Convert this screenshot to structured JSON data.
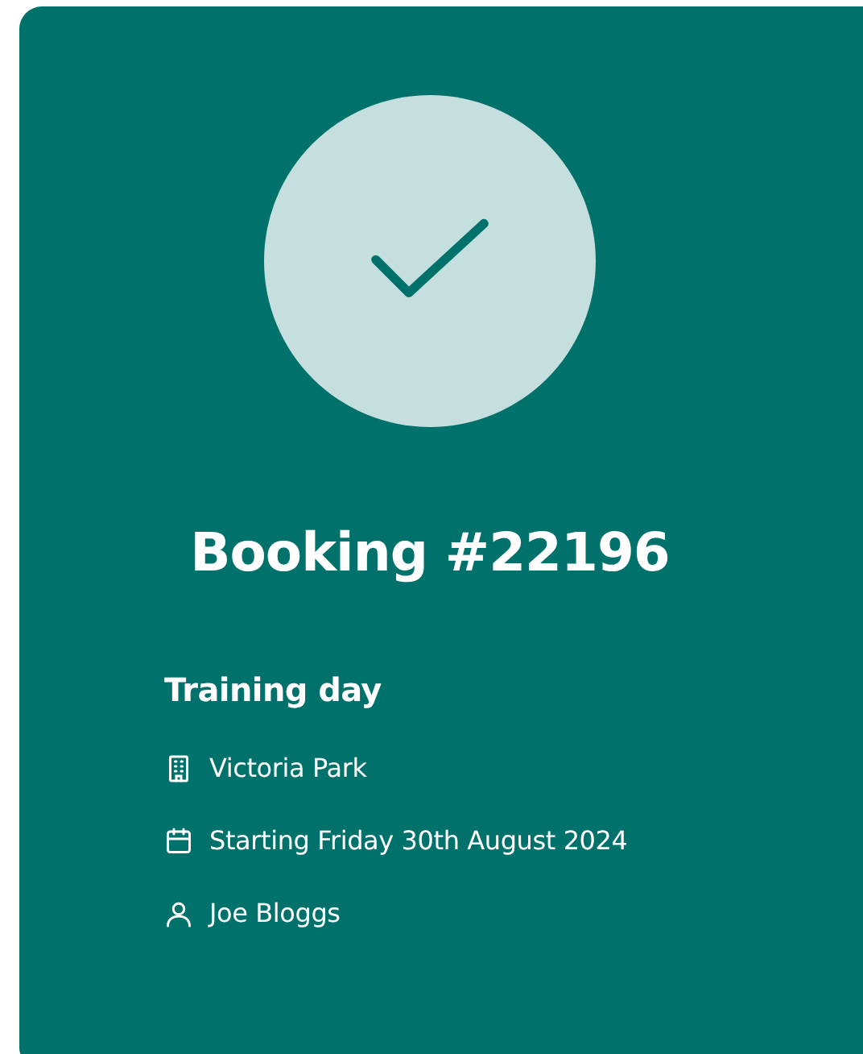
{
  "booking": {
    "title": "Booking #22196",
    "confirmed": true
  },
  "event": {
    "name": "Training day",
    "details": [
      {
        "kind": "venue",
        "text": "Victoria Park"
      },
      {
        "kind": "date",
        "text": "Starting Friday 30th August 2024"
      },
      {
        "kind": "person",
        "text": "Joe Bloggs"
      }
    ]
  }
}
